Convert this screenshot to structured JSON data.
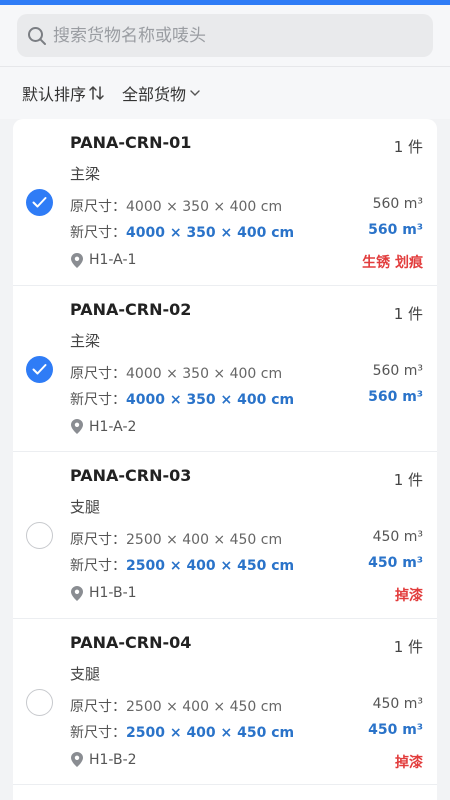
{
  "search": {
    "placeholder": "搜索货物名称或唛头"
  },
  "filters": {
    "sort_label": "默认排序",
    "category_label": "全部货物"
  },
  "labels": {
    "orig": "原尺寸：",
    "new": "新尺寸："
  },
  "items": [
    {
      "code": "PANA-CRN-01",
      "qty": "1 件",
      "category": "主梁",
      "orig_size": "4000 × 350 × 400 cm",
      "orig_vol": "560 m³",
      "new_size": "4000 × 350 × 400 cm",
      "new_vol": "560 m³",
      "location": "H1-A-1",
      "tags": "生锈 划痕",
      "checked": true
    },
    {
      "code": "PANA-CRN-02",
      "qty": "1 件",
      "category": "主梁",
      "orig_size": "4000 × 350 × 400 cm",
      "orig_vol": "560 m³",
      "new_size": "4000 × 350 × 400 cm",
      "new_vol": "560 m³",
      "location": "H1-A-2",
      "tags": "",
      "checked": true
    },
    {
      "code": "PANA-CRN-03",
      "qty": "1 件",
      "category": "支腿",
      "orig_size": "2500 × 400 × 450 cm",
      "orig_vol": "450 m³",
      "new_size": "2500 × 400 × 450 cm",
      "new_vol": "450 m³",
      "location": "H1-B-1",
      "tags": "掉漆",
      "checked": false
    },
    {
      "code": "PANA-CRN-04",
      "qty": "1 件",
      "category": "支腿",
      "orig_size": "2500 × 400 × 450 cm",
      "orig_vol": "450 m³",
      "new_size": "2500 × 400 × 450 cm",
      "new_vol": "450 m³",
      "location": "H1-B-2",
      "tags": "掉漆",
      "checked": false
    }
  ],
  "colors": {
    "accent": "#2f7cf6",
    "new_value": "#2a73c9",
    "tag": "#e23d3d"
  }
}
